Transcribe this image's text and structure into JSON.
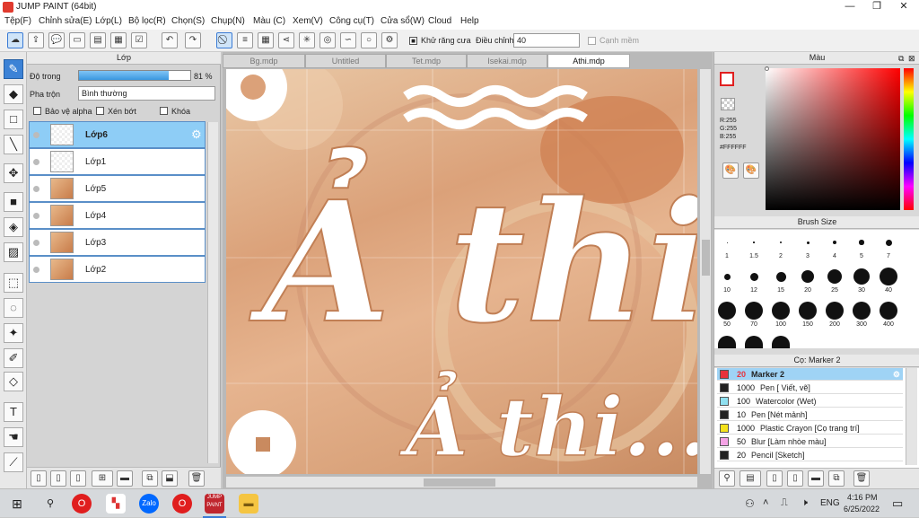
{
  "window": {
    "title": "JUMP PAINT (64bit)",
    "minimize": "—",
    "maximize": "❐",
    "close": "✕"
  },
  "menu": [
    "Tệp(F)",
    "Chỉnh sửa(E)",
    "Lớp(L)",
    "Bộ lọc(R)",
    "Chọn(S)",
    "Chụp(N)",
    "Màu (C)",
    "Xem(V)",
    "Công cụ(T)",
    "Cửa sổ(W)",
    "Cloud",
    "Help"
  ],
  "toolbar": {
    "antialias_label": "Khử răng cưa",
    "adjust_label": "Điều chỉnh",
    "adjust_value": "40",
    "edge_label": "Cạnh mềm"
  },
  "layer_panel": {
    "title": "Lớp",
    "opacity_label": "Độ trong",
    "opacity_value": "81 %",
    "opacity_fraction": 0.81,
    "blend_label": "Pha trộn",
    "blend_value": "Bình thường",
    "protect_alpha": "Bảo vệ alpha",
    "clip": "Xén bớt",
    "lock": "Khóa",
    "layers": [
      "Lớp6",
      "Lớp1",
      "Lớp5",
      "Lớp4",
      "Lớp3",
      "Lớp2"
    ]
  },
  "tabs": [
    "Bg.mdp",
    "Untitled",
    "Tet.mdp",
    "Isekai.mdp",
    "Athi.mdp"
  ],
  "color_panel": {
    "title": "Màu",
    "r": "R:255",
    "g": "G:255",
    "b": "B:255",
    "hex": "#FFFFFF"
  },
  "brush_size_panel": {
    "title": "Brush Size",
    "sizes": [
      "1",
      "1.5",
      "2",
      "3",
      "4",
      "5",
      "7",
      "10",
      "12",
      "15",
      "20",
      "25",
      "30",
      "40",
      "50",
      "70",
      "100",
      "150",
      "200",
      "300",
      "400"
    ]
  },
  "brush_list": {
    "title": "Cọ: Marker 2",
    "items": [
      {
        "size": "20",
        "name": "Marker 2",
        "color": "#e8323c"
      },
      {
        "size": "1000",
        "name": "Pen [ Viết, vẽ]",
        "color": "#222222"
      },
      {
        "size": "100",
        "name": "Watercolor (Wet)",
        "color": "#8fe0f0"
      },
      {
        "size": "10",
        "name": "Pen [Nét mảnh]",
        "color": "#222222"
      },
      {
        "size": "1000",
        "name": "Plastic Crayon [Cọ trang trí]",
        "color": "#f5e21c"
      },
      {
        "size": "50",
        "name": "Blur [Làm nhòe màu]",
        "color": "#f5a3e6"
      },
      {
        "size": "20",
        "name": "Pencil [Sketch]",
        "color": "#222222"
      }
    ]
  },
  "artwork": {
    "text_large": "Ả thi",
    "text_small": "Ả thi..."
  },
  "taskbar": {
    "time": "4:16 PM",
    "date": "6/25/2022",
    "lang": "ENG",
    "zalo": "Zalo",
    "app": "JUMP PAINT"
  }
}
